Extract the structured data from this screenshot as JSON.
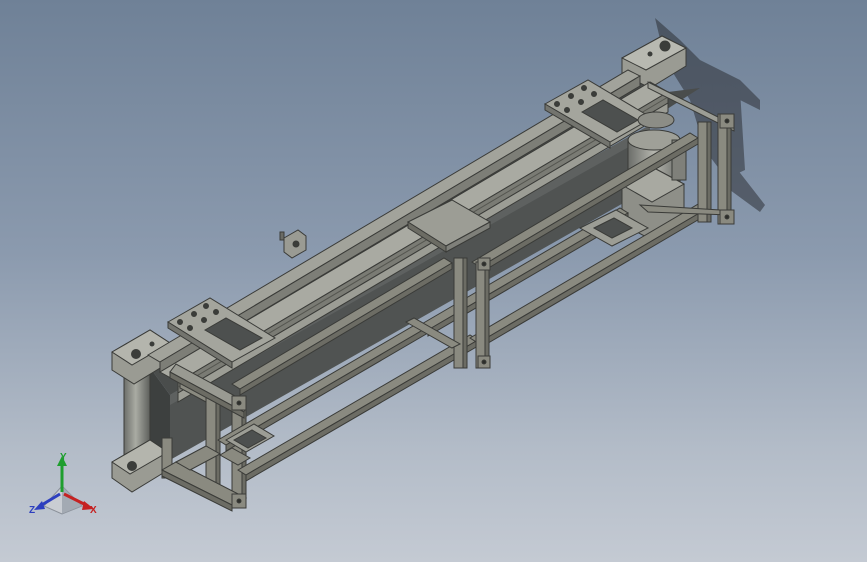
{
  "viewport": {
    "background_top": "#6f8197",
    "background_bottom": "#c4cad3",
    "model": "belt-conveyor-assembly",
    "frame_color": "#8a8a80",
    "belt_color": "#4a4d4c"
  },
  "triad": {
    "x_label": "X",
    "y_label": "Y",
    "z_label": "Z",
    "x_color": "#c52222",
    "y_color": "#1e9e2e",
    "z_color": "#2d3fbf"
  }
}
